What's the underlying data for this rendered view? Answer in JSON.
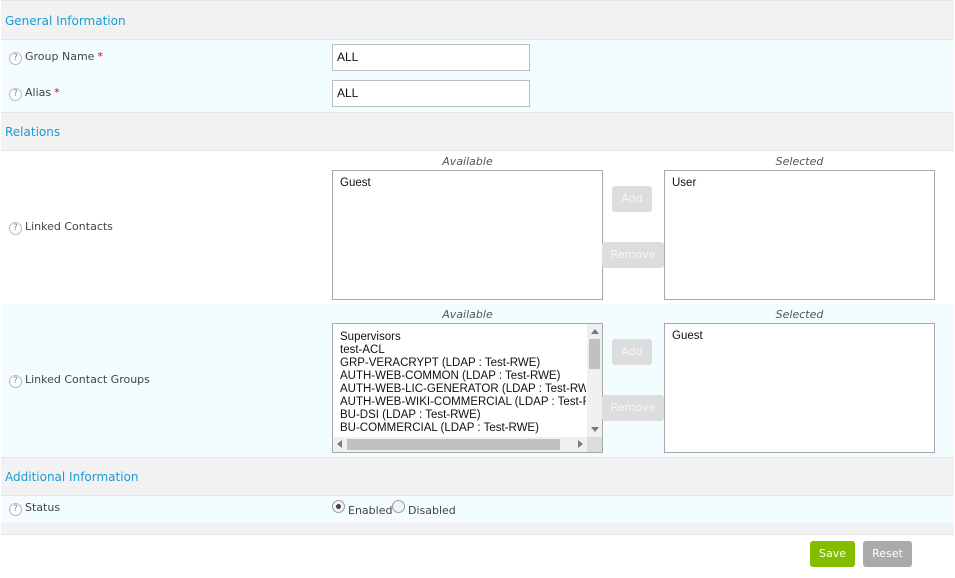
{
  "sections": {
    "general": "General Information",
    "relations": "Relations",
    "additional": "Additional Information"
  },
  "help_icon": {
    "name": "question-circle-icon",
    "glyph": "?"
  },
  "required_marker": "*",
  "fields": {
    "group_name": {
      "label": "Group Name",
      "value": "ALL"
    },
    "alias": {
      "label": "Alias",
      "value": "ALL"
    }
  },
  "linked_contacts": {
    "label": "Linked Contacts",
    "available_header": "Available",
    "selected_header": "Selected",
    "available": [
      "Guest"
    ],
    "selected": [
      "User"
    ],
    "add_label": "Add",
    "remove_label": "Remove"
  },
  "linked_contact_groups": {
    "label": "Linked Contact Groups",
    "available_header": "Available",
    "selected_header": "Selected",
    "available": [
      "Supervisors",
      "test-ACL",
      "GRP-VERACRYPT (LDAP : Test-RWE)",
      "AUTH-WEB-COMMON (LDAP : Test-RWE)",
      "AUTH-WEB-LIC-GENERATOR (LDAP : Test-RWE)",
      "AUTH-WEB-WIKI-COMMERCIAL (LDAP : Test-RWE)",
      "BU-DSI (LDAP : Test-RWE)",
      "BU-COMMERCIAL (LDAP : Test-RWE)"
    ],
    "selected": [
      "Guest"
    ],
    "add_label": "Add",
    "remove_label": "Remove"
  },
  "status": {
    "label": "Status",
    "options": [
      "Enabled",
      "Disabled"
    ],
    "selected": "Enabled"
  },
  "actions": {
    "save": "Save",
    "reset": "Reset"
  },
  "colors": {
    "section_title": "#1a9bd7",
    "section_bg": "#f2f2f2",
    "row_bg": "#f3fcff",
    "save_button": "#84bd00",
    "reset_button": "#aaaaaa",
    "required": "#e00000"
  }
}
